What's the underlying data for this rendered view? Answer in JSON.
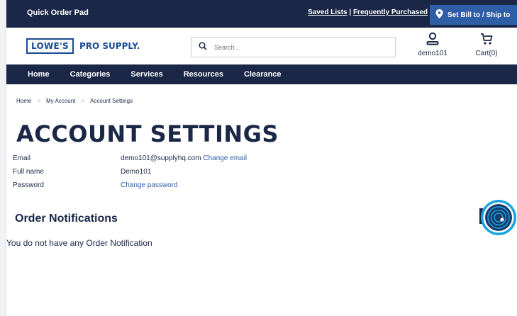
{
  "topbar": {
    "quick_order": "Quick Order Pad",
    "saved_lists": "Saved Lists",
    "divider": " | ",
    "frequently_purchased": "Frequently Purchased",
    "ship_to": "Set Bill to / Ship to"
  },
  "header": {
    "logo_lowes": "LOWE'S",
    "logo_pro": "PRO SUPPLY.",
    "search_placeholder": "Search...",
    "account_label": "demo101",
    "cart_label": "Cart(0)"
  },
  "nav": [
    "Home",
    "Categories",
    "Services",
    "Resources",
    "Clearance"
  ],
  "breadcrumb": [
    "Home",
    "My Account",
    "Account Settings"
  ],
  "page_title": "ACCOUNT SETTINGS",
  "account": {
    "email_label": "Email",
    "email_value": "demo101@supplyhq.com",
    "change_email": "Change email",
    "fullname_label": "Full name",
    "fullname_value": "Demo101",
    "password_label": "Password",
    "change_password": "Change password"
  },
  "notifications": {
    "title": "Order Notifications",
    "empty_message": "You do not have any Order Notification"
  },
  "colors": {
    "navy": "#1a2747",
    "accent_blue": "#2e5fa6",
    "chat_ring": "#19a4e0"
  }
}
